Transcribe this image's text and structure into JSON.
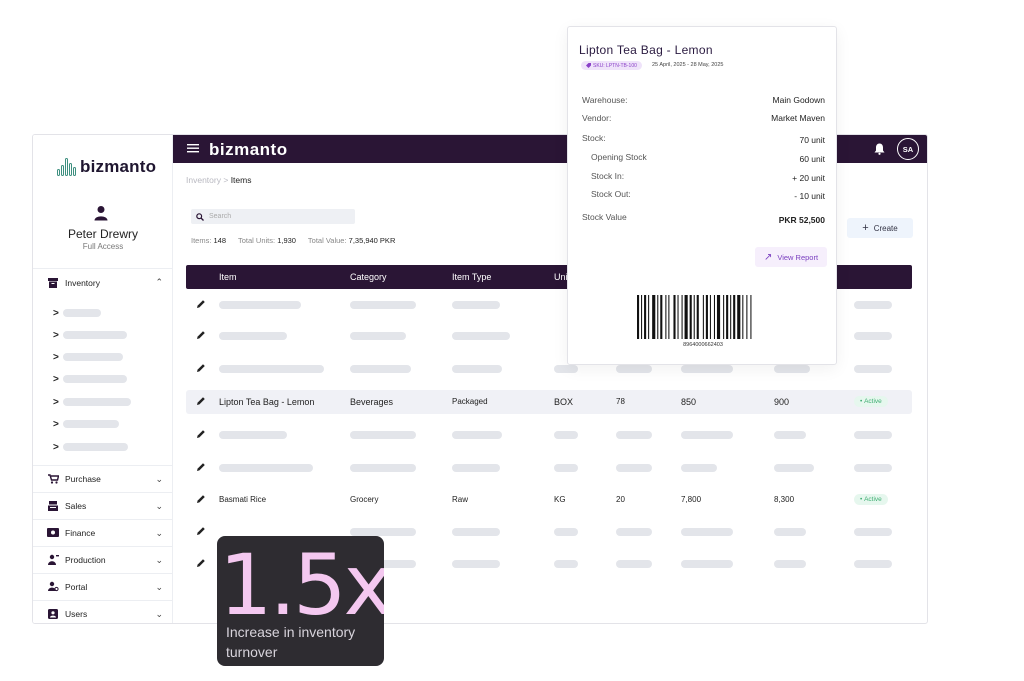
{
  "app": {
    "logo_text": "bizmanto",
    "brand": "bizmanto",
    "avatar_initials": "SA",
    "accent": "#2a1535"
  },
  "user": {
    "name": "Peter Drewry",
    "role": "Full Access"
  },
  "sidebar": {
    "inventory_label": "Inventory",
    "sections": [
      {
        "label": "Purchase",
        "icon": "cart-icon"
      },
      {
        "label": "Sales",
        "icon": "register-icon"
      },
      {
        "label": "Finance",
        "icon": "money-icon"
      },
      {
        "label": "Production",
        "icon": "production-icon"
      },
      {
        "label": "Portal",
        "icon": "portal-icon"
      },
      {
        "label": "Users",
        "icon": "users-icon"
      }
    ]
  },
  "breadcrumb": {
    "parent": "Inventory",
    "separator": ">",
    "current": "Items"
  },
  "search": {
    "placeholder": "Search"
  },
  "stats": {
    "items_label": "Items:",
    "items_value": "148",
    "units_label": "Total Units:",
    "units_value": "1,930",
    "value_label": "Total Value:",
    "value_value": "7,35,940 PKR"
  },
  "create_label": "Create",
  "table": {
    "columns": [
      "Item",
      "Category",
      "Item Type",
      "Uni"
    ],
    "rows": [
      {
        "item": "Lipton Tea Bag - Lemon",
        "category": "Beverages",
        "type": "Packaged",
        "unit": "BOX",
        "qty": "78",
        "c5": "850",
        "c6": "900",
        "status": "Active"
      },
      {
        "item": "Basmati Rice",
        "category": "Grocery",
        "type": "Raw",
        "unit": "KG",
        "qty": "20",
        "c5": "7,800",
        "c6": "8,300",
        "status": "Active"
      }
    ]
  },
  "popover": {
    "title": "Lipton Tea Bag - Lemon",
    "sku": "SKU: LPTN-TB-100",
    "dates": "25 April, 2025 - 28 May, 2025",
    "warehouse_label": "Warehouse:",
    "warehouse": "Main Godown",
    "vendor_label": "Vendor:",
    "vendor": "Market Maven",
    "stock_label": "Stock:",
    "stock": "70 unit",
    "opening_label": "Opening Stock",
    "opening": "60 unit",
    "in_label": "Stock In:",
    "in": "+ 20 unit",
    "out_label": "Stock Out:",
    "out": "- 10 unit",
    "value_label": "Stock Value",
    "value": "PKR 52,500",
    "view_report": "View Report",
    "barcode_number": "8964000662403"
  },
  "statcard": {
    "value": "1.5x",
    "description": "Increase in inventory turnover"
  }
}
